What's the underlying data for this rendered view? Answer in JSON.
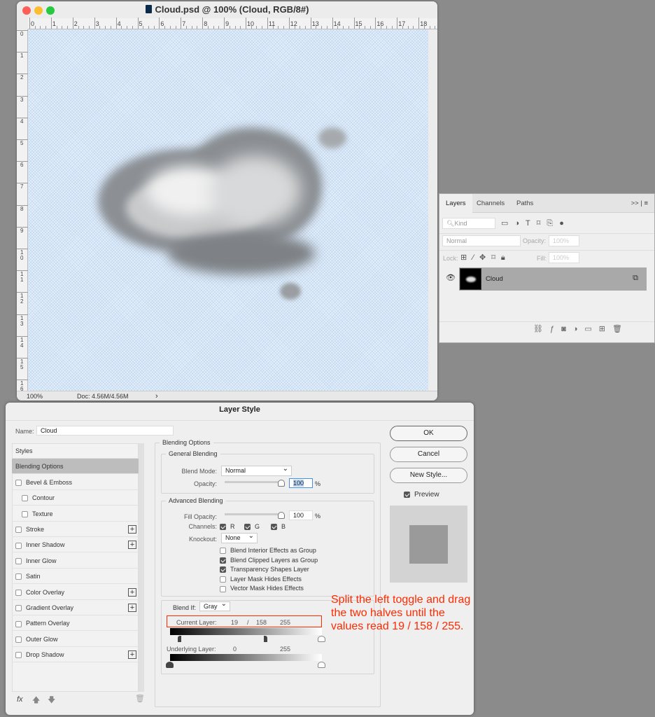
{
  "document": {
    "title": "Cloud.psd @ 100% (Cloud, RGB/8#)",
    "ruler_top": [
      "0",
      "1",
      "2",
      "3",
      "4",
      "5",
      "6",
      "7",
      "8",
      "9",
      "10",
      "11",
      "12",
      "13",
      "14",
      "15",
      "16",
      "17",
      "18"
    ],
    "ruler_left": [
      "0",
      "1",
      "2",
      "3",
      "4",
      "5",
      "6",
      "7",
      "8",
      "9",
      "10",
      "11",
      "12",
      "13",
      "14",
      "15",
      "16"
    ],
    "zoom": "100%",
    "doc_size": "Doc: 4.56M/4.56M",
    "status_arrow": "›"
  },
  "layers_panel": {
    "tabs": [
      "Layers",
      "Channels",
      "Paths"
    ],
    "menu": ">> | ≡",
    "kind": "Kind",
    "blend": "Normal",
    "opacity_label": "Opacity:",
    "opacity": "100%",
    "lock_label": "Lock:",
    "fill_label": "Fill:",
    "fill": "100%",
    "layer_name": "Cloud"
  },
  "dialog": {
    "title": "Layer Style",
    "name_label": "Name:",
    "name_value": "Cloud",
    "styles": [
      {
        "label": "Styles",
        "check": false,
        "indent": false,
        "plus": false
      },
      {
        "label": "Blending Options",
        "selected": true
      },
      {
        "label": "Bevel & Emboss",
        "check": true
      },
      {
        "label": "Contour",
        "check": true,
        "indent": true
      },
      {
        "label": "Texture",
        "check": true,
        "indent": true
      },
      {
        "label": "Stroke",
        "check": true,
        "plus": true
      },
      {
        "label": "Inner Shadow",
        "check": true,
        "plus": true
      },
      {
        "label": "Inner Glow",
        "check": true
      },
      {
        "label": "Satin",
        "check": true
      },
      {
        "label": "Color Overlay",
        "check": true,
        "plus": true
      },
      {
        "label": "Gradient Overlay",
        "check": true,
        "plus": true
      },
      {
        "label": "Pattern Overlay",
        "check": true
      },
      {
        "label": "Outer Glow",
        "check": true
      },
      {
        "label": "Drop Shadow",
        "check": true,
        "plus": true
      }
    ],
    "fx_label": "fx",
    "blending_options": "Blending Options",
    "general_blending": "General Blending",
    "blend_mode_label": "Blend Mode:",
    "blend_mode": "Normal",
    "opacity_label": "Opacity:",
    "opacity": "100",
    "percent": "%",
    "advanced_blending": "Advanced Blending",
    "fill_opacity_label": "Fill Opacity:",
    "fill_opacity": "100",
    "channels_label": "Channels:",
    "channels": [
      "R",
      "G",
      "B"
    ],
    "knockout_label": "Knockout:",
    "knockout": "None",
    "options": [
      {
        "label": "Blend Interior Effects as Group",
        "checked": false
      },
      {
        "label": "Blend Clipped Layers as Group",
        "checked": true
      },
      {
        "label": "Transparency Shapes Layer",
        "checked": true
      },
      {
        "label": "Layer Mask Hides Effects",
        "checked": false
      },
      {
        "label": "Vector Mask Hides Effects",
        "checked": false
      }
    ],
    "blend_if_label": "Blend If:",
    "blend_if": "Gray",
    "current_layer_label": "Current Layer:",
    "current_values": {
      "low_a": "19",
      "sep": "/",
      "low_b": "158",
      "high": "255"
    },
    "underlying_label": "Underlying Layer:",
    "underlying_values": {
      "low": "0",
      "high": "255"
    },
    "ok": "OK",
    "cancel": "Cancel",
    "new_style": "New Style...",
    "preview": "Preview"
  },
  "annotation": {
    "text": "Split the left toggle and drag the two halves until the values read 19 / 158 / 255.",
    "color": "#ff2a00"
  }
}
